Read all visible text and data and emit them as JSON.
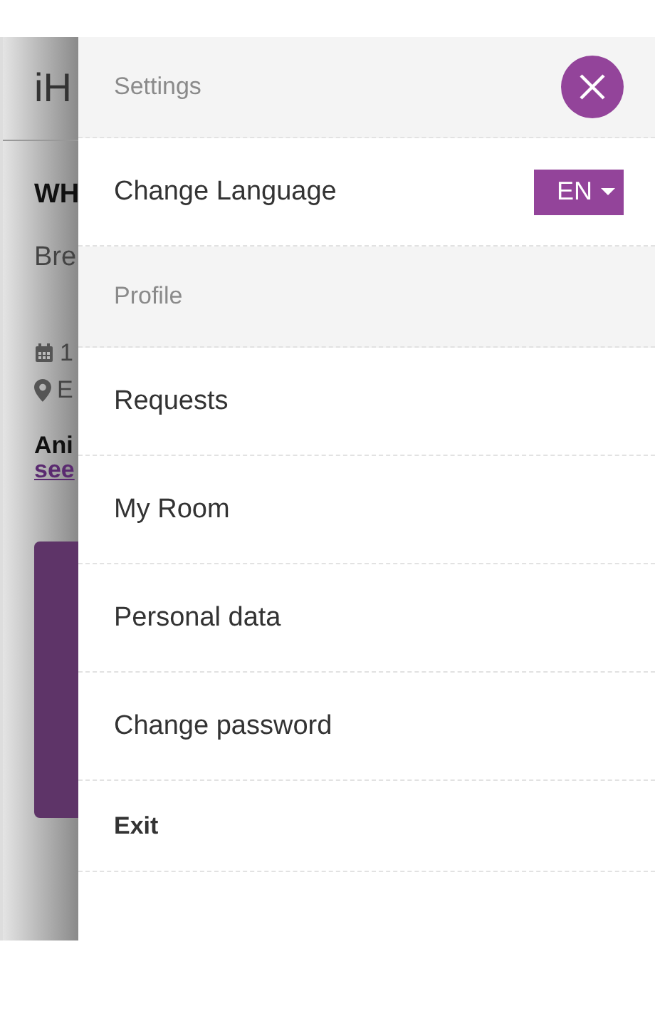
{
  "background_page": {
    "logo": "iH",
    "title": "WH",
    "subtitle": "Bre",
    "date": "1",
    "location": "E",
    "section_title": "Ani",
    "link": "see"
  },
  "drawer": {
    "title": "Settings",
    "language": {
      "label": "Change Language",
      "value": "EN"
    },
    "sections": [
      {
        "title": "Profile",
        "items": [
          {
            "label": "Requests",
            "kind": "link"
          },
          {
            "label": "My Room",
            "kind": "link"
          },
          {
            "label": "Personal data",
            "kind": "link"
          },
          {
            "label": "Change password",
            "kind": "link"
          },
          {
            "label": "Exit",
            "kind": "exit"
          }
        ]
      }
    ]
  }
}
